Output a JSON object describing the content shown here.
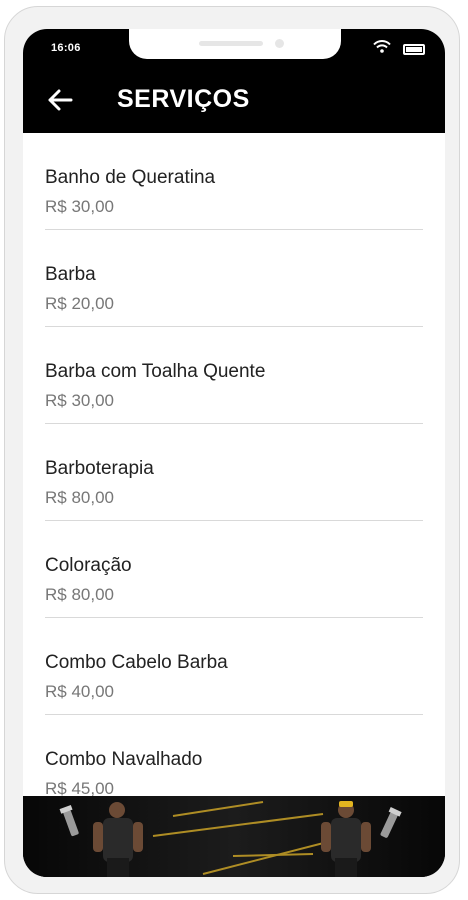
{
  "status_bar": {
    "time": "16:06",
    "icons": [
      "wifi-icon",
      "battery-icon"
    ]
  },
  "header": {
    "title": "SERVIÇOS",
    "back_icon": "arrow-left-icon"
  },
  "services": [
    {
      "name": "Banho de Queratina",
      "price": "R$ 30,00"
    },
    {
      "name": "Barba",
      "price": "R$ 20,00"
    },
    {
      "name": "Barba com Toalha Quente",
      "price": "R$ 30,00"
    },
    {
      "name": "Barboterapia",
      "price": "R$ 80,00"
    },
    {
      "name": "Coloração",
      "price": "R$ 80,00"
    },
    {
      "name": "Combo Cabelo Barba",
      "price": "R$ 40,00"
    },
    {
      "name": "Combo Navalhado",
      "price": "R$ 45,00"
    }
  ],
  "colors": {
    "header_bg": "#000000",
    "accent_gold": "#c9a227",
    "text_primary": "#222222",
    "text_secondary": "#777777"
  }
}
